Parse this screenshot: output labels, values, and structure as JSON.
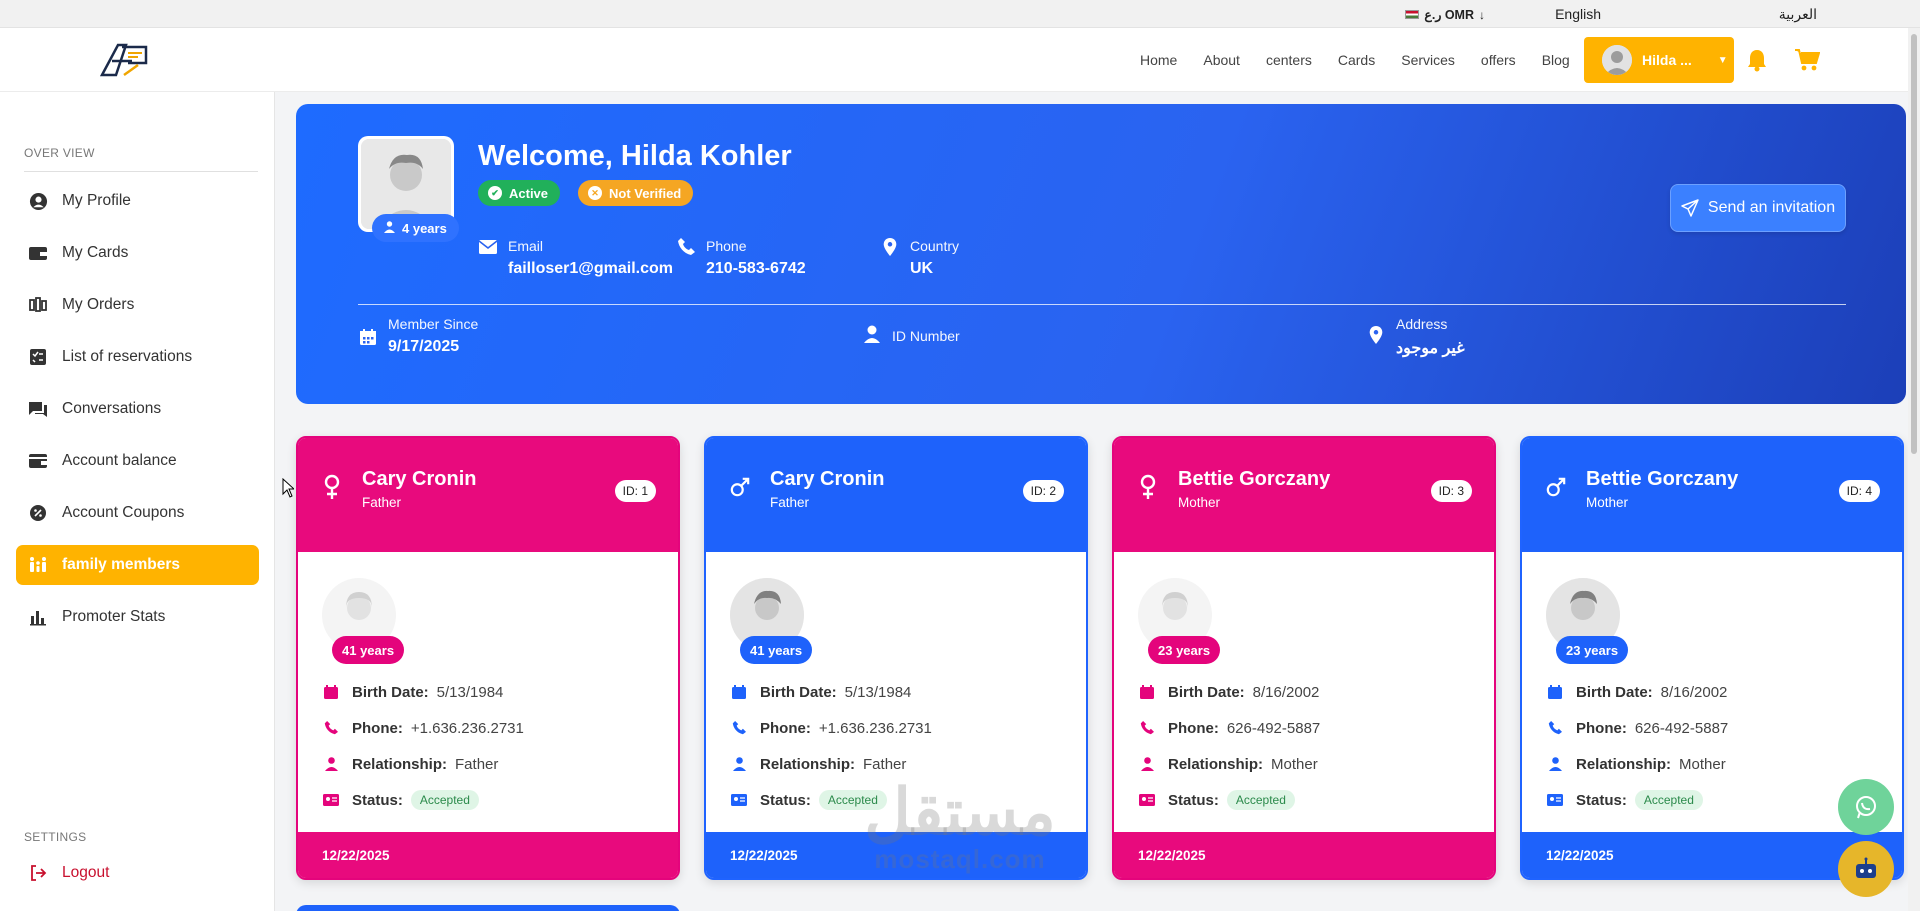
{
  "topbar": {
    "currency_label": "ر.ع OMR",
    "currency_arrow": "↓",
    "lang_en": "English",
    "lang_ar": "العربية"
  },
  "header": {
    "nav": [
      "Home",
      "About",
      "centers",
      "Cards",
      "Services",
      "offers",
      "Blog"
    ],
    "user_label": "Hilda ...",
    "accent_color": "#ffb300"
  },
  "sidebar": {
    "overview_label": "OVER VIEW",
    "items": [
      {
        "label": "My Profile",
        "icon": "user-circle-icon"
      },
      {
        "label": "My Cards",
        "icon": "wallet-icon"
      },
      {
        "label": "My Orders",
        "icon": "chart-candles-icon"
      },
      {
        "label": "List of reservations",
        "icon": "list-check-icon"
      },
      {
        "label": "Conversations",
        "icon": "chat-icon"
      },
      {
        "label": "Account balance",
        "icon": "wallet-balance-icon"
      },
      {
        "label": "Account Coupons",
        "icon": "coupon-icon"
      },
      {
        "label": "family members",
        "icon": "family-icon",
        "active": true
      },
      {
        "label": "Promoter Stats",
        "icon": "bar-chart-icon"
      }
    ],
    "settings_label": "SETTINGS",
    "logout_label": "Logout"
  },
  "profile": {
    "welcome": "Welcome, Hilda Kohler",
    "age_badge": "4 years",
    "status_active": "Active",
    "status_verified": "Not Verified",
    "email_label": "Email",
    "email": "failloser1@gmail.com",
    "phone_label": "Phone",
    "phone": "210-583-6742",
    "country_label": "Country",
    "country": "UK",
    "member_since_label": "Member Since",
    "member_since": "9/17/2025",
    "id_label": "ID Number",
    "address_label": "Address",
    "address": "غير موجود",
    "invite_label": "Send an invitation"
  },
  "labels": {
    "birth": "Birth Date:",
    "phone": "Phone:",
    "relationship": "Relationship:",
    "status": "Status:"
  },
  "members": [
    {
      "name": "Cary Cronin",
      "role": "Father",
      "id": "ID: 1",
      "gender": "female",
      "theme": "pink",
      "age": "41 years",
      "birth": "5/13/1984",
      "phone": "+1.636.236.2731",
      "relationship": "Father",
      "status": "Accepted",
      "date": "12/22/2025"
    },
    {
      "name": "Cary Cronin",
      "role": "Father",
      "id": "ID: 2",
      "gender": "male",
      "theme": "blue",
      "age": "41 years",
      "birth": "5/13/1984",
      "phone": "+1.636.236.2731",
      "relationship": "Father",
      "status": "Accepted",
      "date": "12/22/2025"
    },
    {
      "name": "Bettie Gorczany",
      "role": "Mother",
      "id": "ID: 3",
      "gender": "female",
      "theme": "pink",
      "age": "23 years",
      "birth": "8/16/2002",
      "phone": "626-492-5887",
      "relationship": "Mother",
      "status": "Accepted",
      "date": "12/22/2025"
    },
    {
      "name": "Bettie Gorczany",
      "role": "Mother",
      "id": "ID: 4",
      "gender": "male",
      "theme": "blue",
      "age": "23 years",
      "birth": "8/16/2002",
      "phone": "626-492-5887",
      "relationship": "Mother",
      "status": "Accepted",
      "date": "12/22/2025"
    }
  ],
  "watermark": {
    "ar": "مستقل",
    "en": "mostaql.com"
  }
}
